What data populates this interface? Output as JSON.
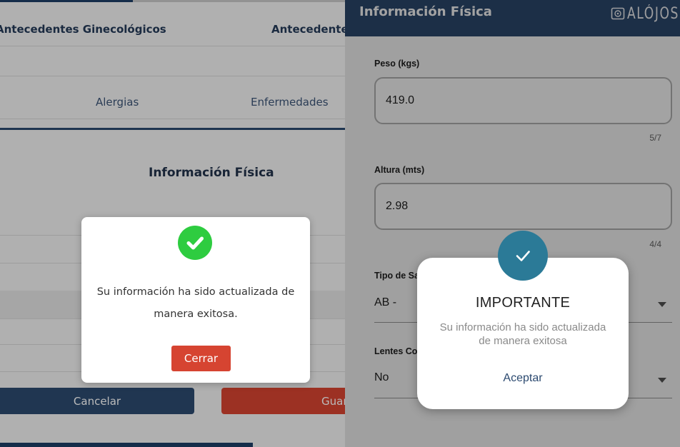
{
  "left": {
    "tabs_row1": [
      "Antecedentes Ginecológicos",
      "Antecedentes"
    ],
    "tabs_row2": [
      "Alergias",
      "Enfermedades"
    ],
    "section_title": "Información Física",
    "cancel_label": "Cancelar",
    "save_label": "Guardar",
    "modal": {
      "message": "Su información ha sido actualizada de manera exitosa.",
      "close_label": "Cerrar",
      "success_color": "#2ecc40"
    }
  },
  "right": {
    "header_title": "Información Física",
    "logo_text": "ALÓJOSÉ",
    "fields": {
      "peso_label": "Peso (kgs)",
      "peso_value": "419.0",
      "peso_counter": "5/7",
      "altura_label": "Altura (mts)",
      "altura_value": "2.98",
      "altura_counter": "4/4",
      "sangre_label": "Tipo de Sa",
      "sangre_value": "AB -",
      "lentes_label": "Lentes Co",
      "lentes_value": "No"
    },
    "modal": {
      "title": "IMPORTANTE",
      "message": "Su información ha sido actualizada de manera exitosa",
      "accept_label": "Aceptar",
      "check_color": "#2b7a97"
    }
  },
  "colors": {
    "navy": "#2c4a70",
    "red": "#d64431"
  }
}
